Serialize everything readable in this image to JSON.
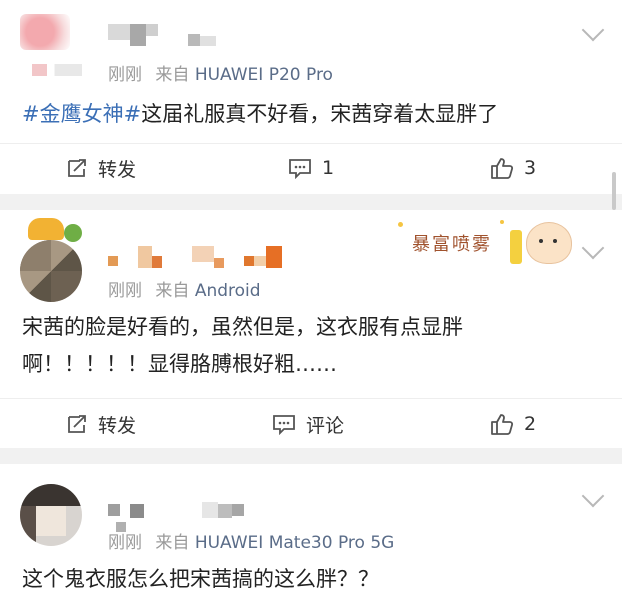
{
  "colors": {
    "topic_blue": "#3b6fb6",
    "source_gray": "#9a9a9a",
    "separator": "#f1f1f1"
  },
  "posts": [
    {
      "time_label": "刚刚",
      "source_prefix": "来自",
      "source": "HUAWEI P20 Pro",
      "topic": "#金鹰女神#",
      "text_lines": [
        "这届礼服真不好看，宋茜穿着太显胖了"
      ],
      "actions": {
        "repost_label": "转发",
        "comment_count": "1",
        "like_count": "3"
      }
    },
    {
      "time_label": "刚刚",
      "source_prefix": "来自",
      "source": "Android",
      "badge_text": "暴富喷雾",
      "text_lines": [
        "宋茜的脸是好看的，虽然但是，这衣服有点显胖",
        "啊！！！！！显得胳膊根好粗……"
      ],
      "actions": {
        "repost_label": "转发",
        "comment_label": "评论",
        "like_count": "2"
      }
    },
    {
      "time_label": "刚刚",
      "source_prefix": "来自",
      "source": "HUAWEI Mate30 Pro 5G",
      "text_lines": [
        "这个鬼衣服怎么把宋茜搞的这么胖？？"
      ]
    }
  ],
  "icons": {
    "repost": "repost-icon",
    "comment": "comment-icon",
    "like": "thumbs-up-icon",
    "menu": "chevron-down-icon"
  }
}
